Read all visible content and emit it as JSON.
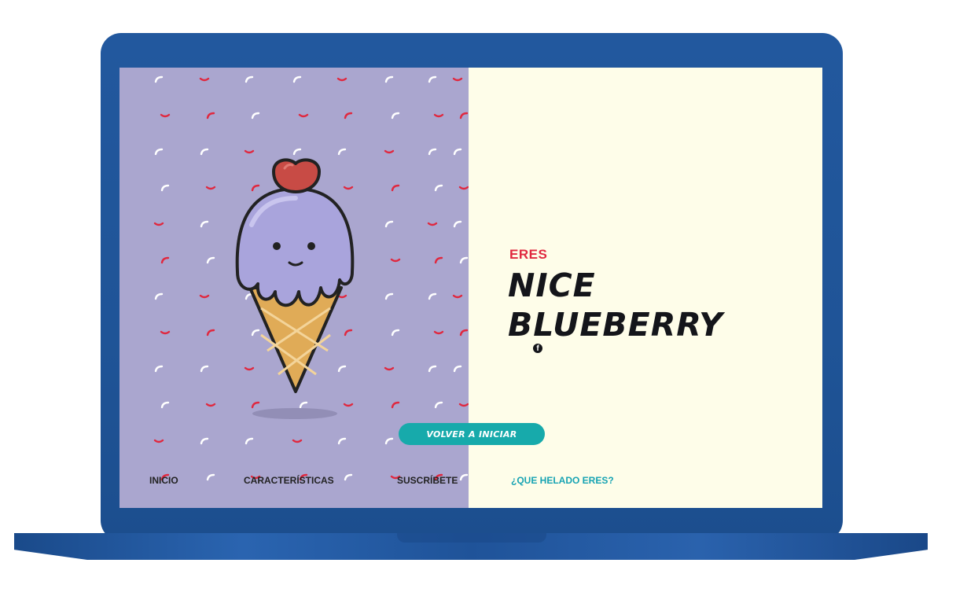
{
  "result": {
    "eyebrow": "ERES",
    "line1": "NICE",
    "line2": "BLUEBERRY"
  },
  "social": {
    "icon": "facebook-icon",
    "glyph": "f"
  },
  "actions": {
    "restart_label": "VOLVER A INICIAR"
  },
  "nav": {
    "items": [
      {
        "label": "INICIO"
      },
      {
        "label": "CARACTERÍSTICAS"
      },
      {
        "label": "SUSCRÍBETE"
      },
      {
        "label": "¿QUE HELADO ERES?"
      }
    ]
  },
  "colors": {
    "left_bg": "#aaa6cf",
    "right_bg": "#fefde9",
    "accent_red": "#e0283f",
    "accent_teal": "#17aaab",
    "laptop_blue": "#1f5497"
  }
}
